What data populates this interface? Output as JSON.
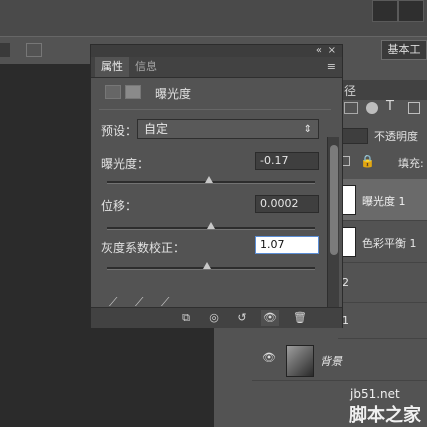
{
  "workspace": {
    "label": "基本工"
  },
  "properties": {
    "tabs": [
      "属性",
      "信息"
    ],
    "section_title": "曝光度",
    "preset": {
      "label": "预设：",
      "value": "自定"
    },
    "fields": [
      {
        "label": "曝光度：",
        "value": "-0.17",
        "slider_percent": 49
      },
      {
        "label": "位移：",
        "value": "0.0002",
        "slider_percent": 50
      },
      {
        "label": "灰度系数校正：",
        "value": "1.07",
        "slider_percent": 48
      }
    ]
  },
  "layers": {
    "tab_label": "径",
    "opacity_label": "不透明度",
    "fill_label": "填充:",
    "items": [
      {
        "name": "曝光度 1"
      },
      {
        "name": "色彩平衡 1"
      },
      {
        "name": "2"
      },
      {
        "name": "1"
      },
      {
        "name": "背景"
      }
    ]
  },
  "watermark": {
    "line1": "jb51.net",
    "line2": "脚本之家"
  },
  "colors": {
    "panel": "#535353",
    "active_field": "#ffffff",
    "accent": "#5b8ed6"
  }
}
